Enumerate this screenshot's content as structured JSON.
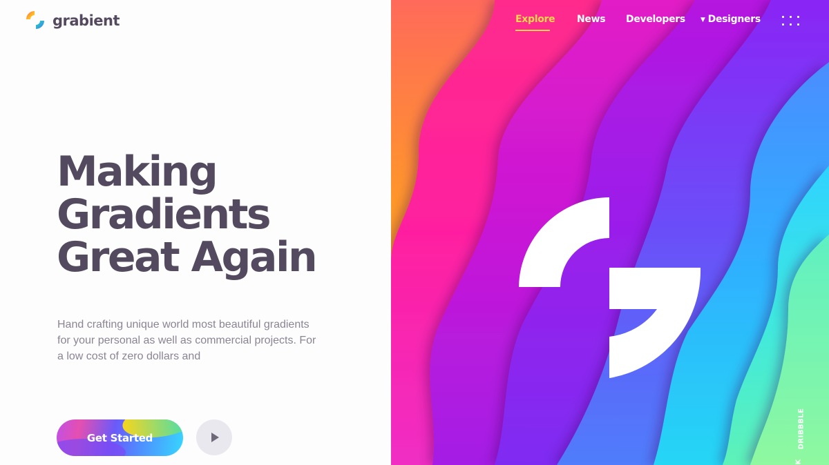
{
  "brand": {
    "name": "grabient",
    "logo_icon": "grabient-logo-icon"
  },
  "nav": {
    "items": [
      {
        "label": "Explore",
        "active": true
      },
      {
        "label": "News",
        "active": false
      },
      {
        "label": "Developers",
        "active": false
      },
      {
        "label": "Designers",
        "active": false,
        "has_dropdown": true
      }
    ],
    "menu_icon": "grid-dots-icon",
    "active_color": "#ffd84a"
  },
  "hero": {
    "headline": [
      "Making",
      "Gradients",
      "Great Again"
    ],
    "description": "Hand crafting unique world most beautiful gradients for your personal as well as commercial projects. For a low cost of zero dollars and",
    "cta_label": "Get Started",
    "play_icon": "play-icon"
  },
  "side_link": {
    "label": "DRIBBBLE",
    "cut_label": "K"
  },
  "colors": {
    "headline": "#534a5f",
    "text": "#8b8494",
    "accent": "#ffd84a"
  }
}
